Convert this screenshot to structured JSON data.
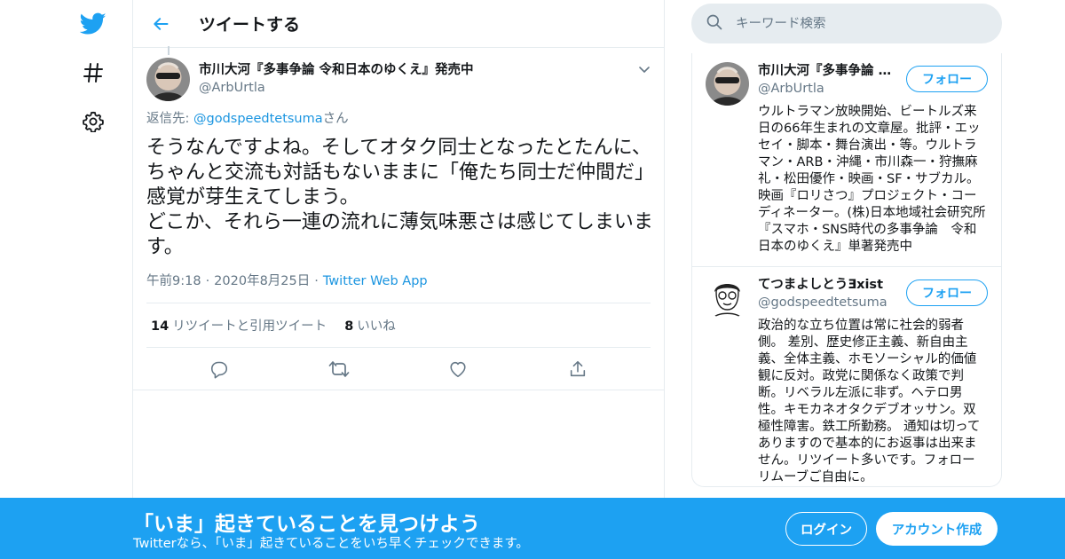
{
  "nav": {
    "icons": [
      "twitter-bird-icon",
      "hashtag-icon",
      "gear-icon"
    ],
    "brand_color": "#1da1f2"
  },
  "header": {
    "title": "ツイートする",
    "back_icon": "arrow-left-icon"
  },
  "tweet": {
    "author_name": "市川大河『多事争論 令和日本のゆくえ』発売中",
    "author_handle": "@ArbUrtla",
    "reply_label": "返信先: ",
    "reply_to": "@godspeedtetsuma",
    "reply_suffix": "さん",
    "text": "そうなんですよね。そしてオタク同士となったとたんに、ちゃんと交流も対話もないままに「俺たち同士だ仲間だ」感覚が芽生えてしまう。\nどこか、それら一連の流れに薄気味悪さは感じてしまいます。",
    "time": "午前9:18",
    "date": "2020年8月25日",
    "source": "Twitter Web App",
    "retweet_count": "14",
    "retweet_label": "リツイートと引用ツイート",
    "like_count": "8",
    "like_label": "いいね",
    "actions": [
      "reply-icon",
      "retweet-icon",
      "like-icon",
      "share-icon"
    ]
  },
  "search": {
    "placeholder": "キーワード検索"
  },
  "users": [
    {
      "name": "市川大河『多事争論 令和日本のゆくえ』発売中",
      "handle": "@ArbUrtla",
      "follow_label": "フォロー",
      "bio": "ウルトラマン放映開始、ビートルズ来日の66年生まれの文章屋。批評・エッセイ・脚本・舞台演出・等。ウルトラマン・ARB・沖縄・市川森一・狩撫麻礼・松田優作・映画・SF・サブカル。映画『ロリさつ』プロジェクト・コーディネーター。(株)日本地域社会研究所『スマホ・SNS時代の多事争論　令和日本のゆくえ』単著発売中"
    },
    {
      "name": "てつまよしとうƎxist",
      "handle": "@godspeedtetsuma",
      "follow_label": "フォロー",
      "bio": "政治的な立ち位置は常に社会的弱者側。 差別、歴史修正主義、新自由主義、全体主義、ホモソーシャル的価値観に反対。政党に関係なく政策で判断。リベラル左派に非ず。ヘテロ男性。キモカネオタクデブオッサン。双極性障害。鉄工所勤務。 通知は切ってありますので基本的にお返事は出来ません。リツイート多いです。フォローリムーブご自由に。"
    }
  ],
  "bottom_bar": {
    "title": "「いま」起きていることを見つけよう",
    "subtitle": "Twitterなら、「いま」起きていることをいち早くチェックできます。",
    "login_label": "ログイン",
    "signup_label": "アカウント作成"
  }
}
